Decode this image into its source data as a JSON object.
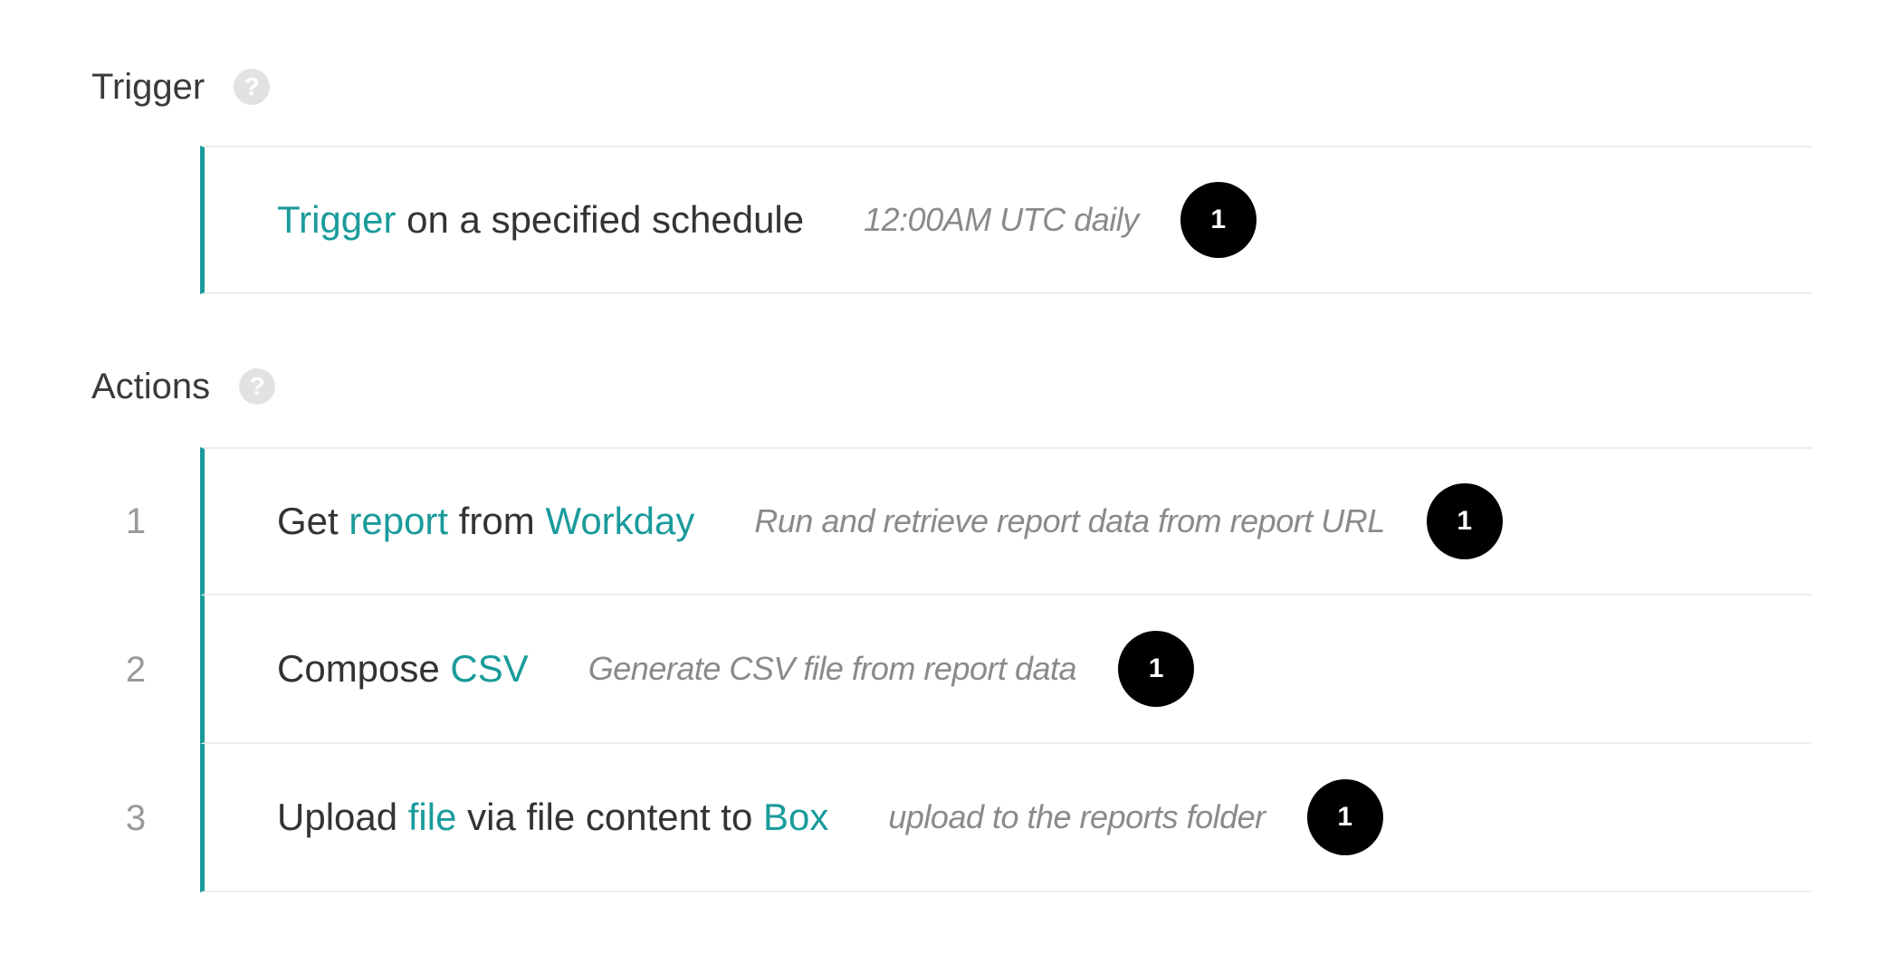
{
  "trigger_section": {
    "title": "Trigger",
    "help_icon": "question-mark-icon",
    "step": {
      "link": "Trigger",
      "text": " on a specified schedule",
      "description": "12:00AM UTC daily",
      "badge": "1"
    }
  },
  "actions_section": {
    "title": "Actions",
    "help_icon": "question-mark-icon",
    "steps": [
      {
        "number": "1",
        "prefix": "Get ",
        "link1": "report",
        "middle": " from ",
        "link2": "Workday",
        "description": "Run and retrieve report data from report URL",
        "badge": "1"
      },
      {
        "number": "2",
        "prefix": "Compose ",
        "link1": "CSV",
        "description": "Generate CSV file from report data",
        "badge": "1"
      },
      {
        "number": "3",
        "prefix": "Upload ",
        "link1": "file",
        "middle": " via file content to ",
        "link2": "Box",
        "description": "upload to the reports folder",
        "badge": "1"
      }
    ]
  },
  "colors": {
    "accent": "#1a9b9b",
    "badge": "#000000",
    "description": "#8a8a8a"
  }
}
